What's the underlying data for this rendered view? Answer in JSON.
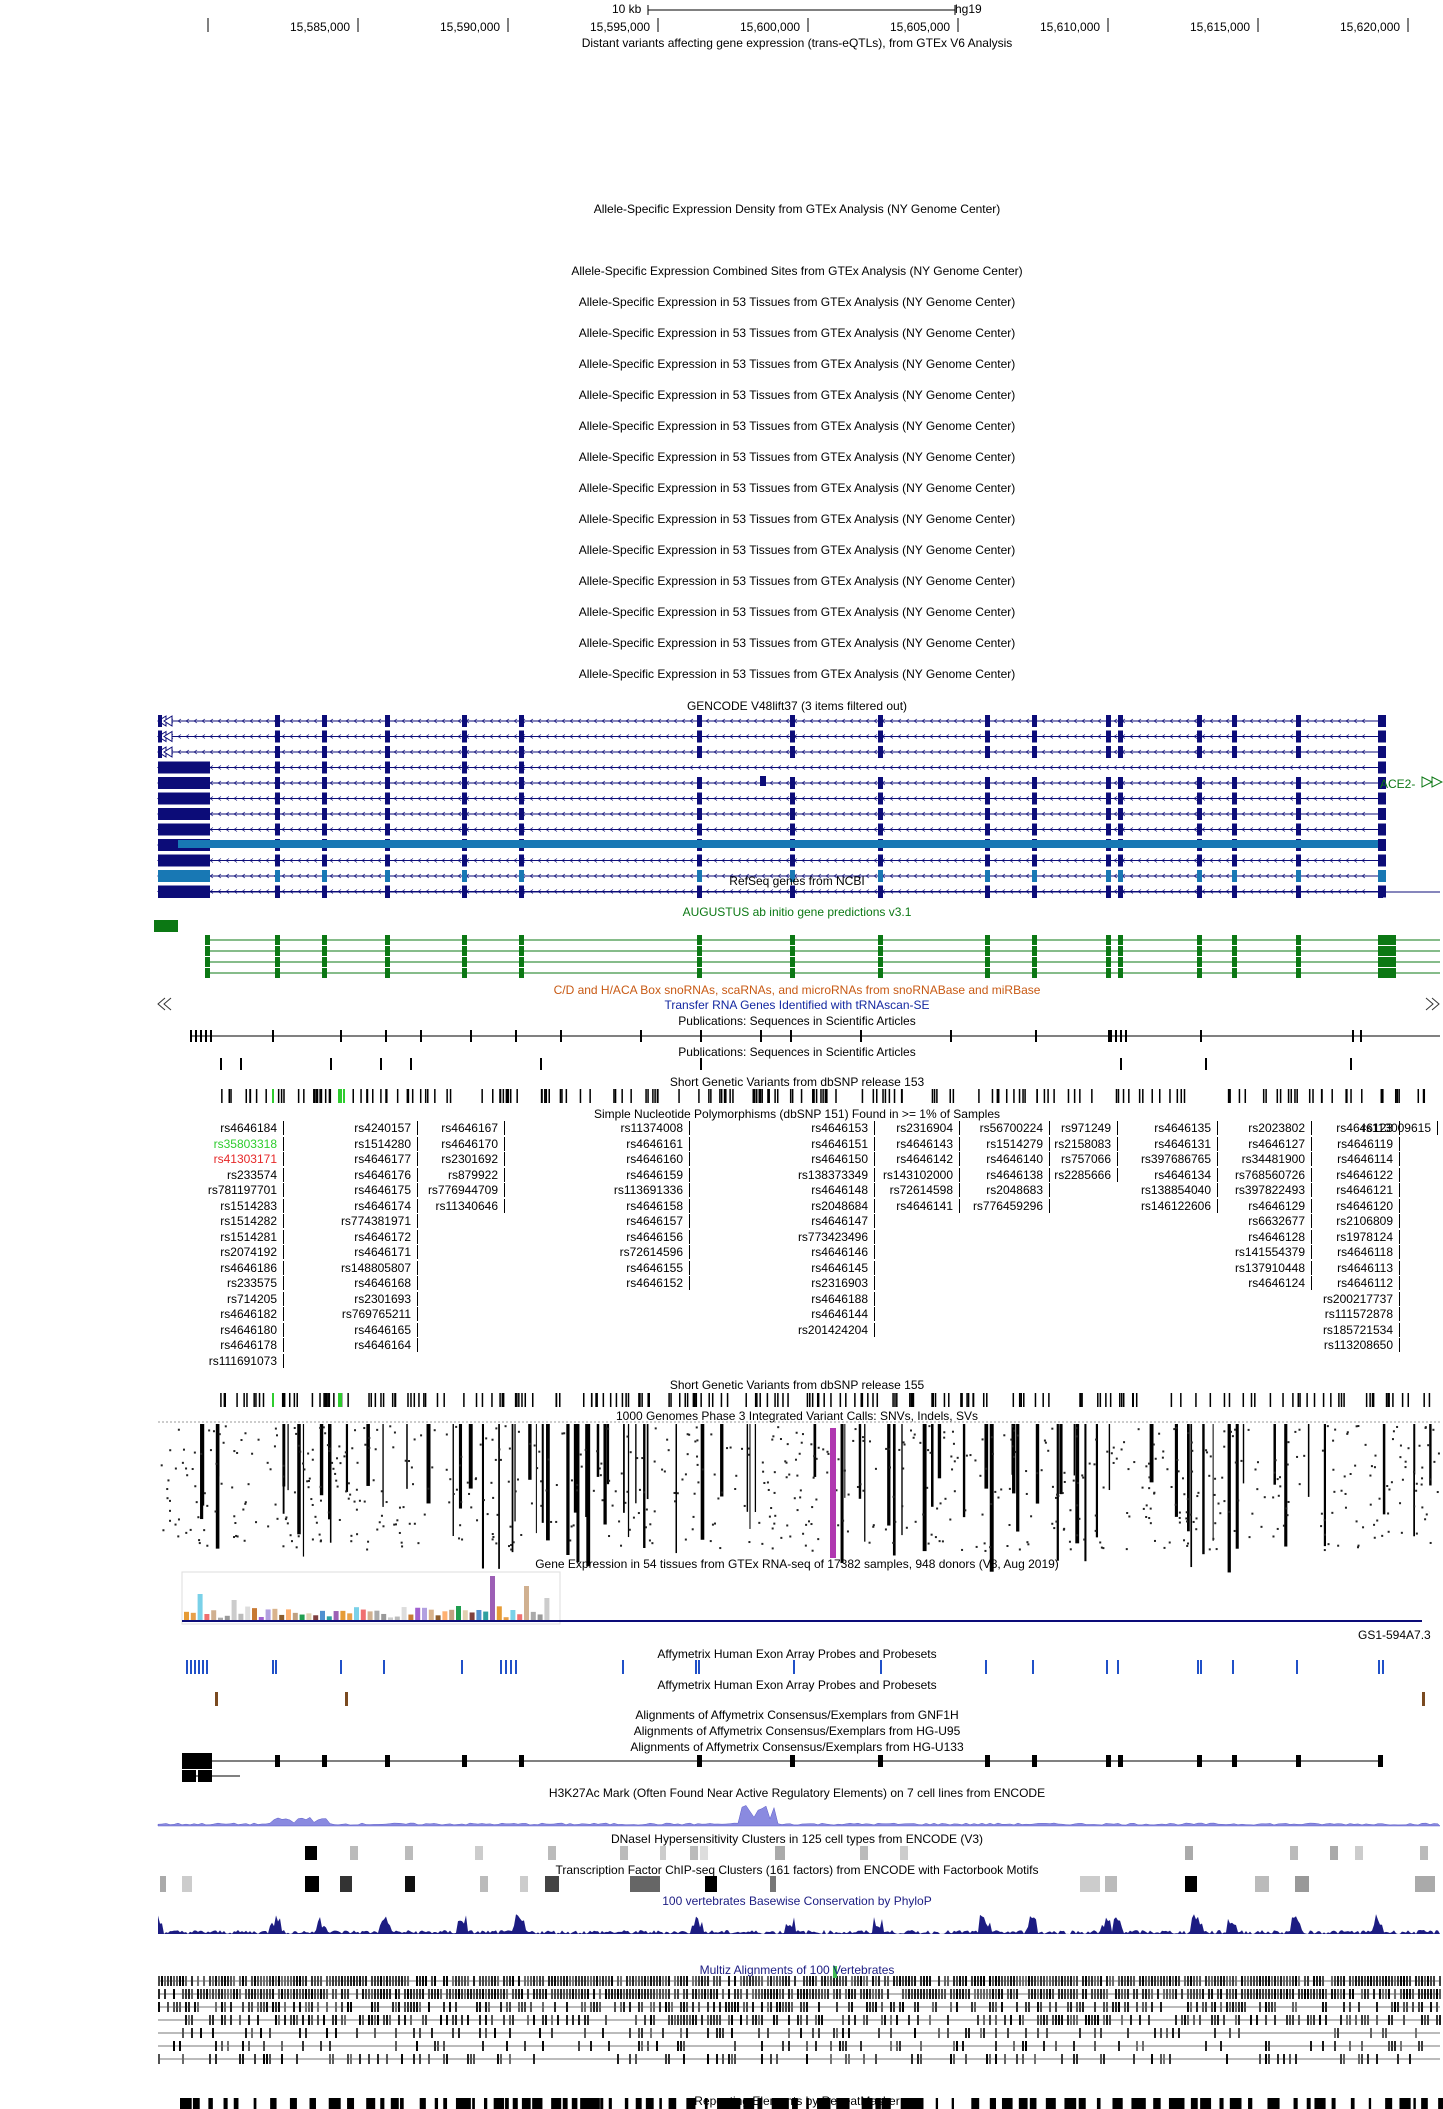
{
  "ruler": {
    "scale_label": "10 kb",
    "assembly": "hg19",
    "coordinates": [
      "15,585,000",
      "15,590,000",
      "15,595,000",
      "15,600,000",
      "15,605,000",
      "15,610,000",
      "15,615,000",
      "15,620,000"
    ]
  },
  "tracks": {
    "trans_eqtl": "Distant variants affecting gene expression (trans-eQTLs), from GTEx V6 Analysis",
    "ase_density": "Allele-Specific Expression Density from GTEx Analysis (NY Genome Center)",
    "ase_combined": "Allele-Specific Expression Combined Sites from GTEx Analysis (NY Genome Center)",
    "ase_tissues": [
      "Allele-Specific Expression in 53 Tissues from GTEx Analysis (NY Genome Center)",
      "Allele-Specific Expression in 53 Tissues from GTEx Analysis (NY Genome Center)",
      "Allele-Specific Expression in 53 Tissues from GTEx Analysis (NY Genome Center)",
      "Allele-Specific Expression in 53 Tissues from GTEx Analysis (NY Genome Center)",
      "Allele-Specific Expression in 53 Tissues from GTEx Analysis (NY Genome Center)",
      "Allele-Specific Expression in 53 Tissues from GTEx Analysis (NY Genome Center)",
      "Allele-Specific Expression in 53 Tissues from GTEx Analysis (NY Genome Center)",
      "Allele-Specific Expression in 53 Tissues from GTEx Analysis (NY Genome Center)",
      "Allele-Specific Expression in 53 Tissues from GTEx Analysis (NY Genome Center)",
      "Allele-Specific Expression in 53 Tissues from GTEx Analysis (NY Genome Center)",
      "Allele-Specific Expression in 53 Tissues from GTEx Analysis (NY Genome Center)",
      "Allele-Specific Expression in 53 Tissues from GTEx Analysis (NY Genome Center)",
      "Allele-Specific Expression in 53 Tissues from GTEx Analysis (NY Genome Center)"
    ],
    "gencode": "GENCODE V48lift37 (3 items filtered out)",
    "gencode_gene": "ACE2-",
    "refseq": "RefSeq genes from NCBI",
    "augustus": "AUGUSTUS ab initio gene predictions v3.1",
    "snorna": "C/D and H/ACA Box snoRNAs, scaRNAs, and microRNAs from snoRNABase and miRBase",
    "trna": "Transfer RNA Genes Identified with tRNAscan-SE",
    "pubs1": "Publications: Sequences in Scientific Articles",
    "pubs2": "Publications: Sequences in Scientific Articles",
    "dbsnp153": "Short Genetic Variants from dbSNP release 153",
    "snp151": "Simple Nucleotide Polymorphisms (dbSNP 151) Found in >= 1% of Samples",
    "dbsnp155": "Short Genetic Variants from dbSNP release 155",
    "kg3": "1000 Genomes Phase 3 Integrated Variant Calls: SNVs, Indels, SVs",
    "gtex": "Gene Expression in 54 tissues from GTEx RNA-seq of 17382 samples, 948 donors (V8, Aug 2019)",
    "gtex_gene": "GS1-594A7.3",
    "affy_exon1": "Affymetrix Human Exon Array Probes and Probesets",
    "affy_exon2": "Affymetrix Human Exon Array Probes and Probesets",
    "affy_gnf1h": "Alignments of Affymetrix Consensus/Exemplars from GNF1H",
    "affy_u95": "Alignments of Affymetrix Consensus/Exemplars from HG-U95",
    "affy_u133": "Alignments of Affymetrix Consensus/Exemplars from HG-U133",
    "h3k27ac": "H3K27Ac Mark (Often Found Near Active Regulatory Elements) on 7 cell lines from ENCODE",
    "dnase": "DNaseI Hypersensitivity Clusters in 125 cell types from ENCODE (V3)",
    "tfbs": "Transcription Factor ChIP-seq Clusters (161 factors) from ENCODE with Factorbook Motifs",
    "phylop": "100 vertebrates Basewise Conservation by PhyloP",
    "multiz": "Multiz Alignments of 100 Vertebrates",
    "rmsk": "Repeating Elements by RepeatMasker"
  },
  "snps": {
    "col1": [
      "rs4646184",
      "rs35803318",
      "rs41303171",
      "rs233574",
      "rs781197701",
      "rs1514283",
      "rs1514282",
      "rs1514281",
      "rs2074192",
      "rs4646186",
      "rs233575",
      "rs714205",
      "rs4646182",
      "rs4646180",
      "rs4646178",
      "rs111691073"
    ],
    "col2": [
      "rs4240157",
      "rs1514280",
      "rs4646177",
      "rs4646176",
      "rs4646175",
      "rs4646174",
      "rs774381971",
      "rs4646172",
      "rs4646171",
      "rs148805807",
      "rs4646168",
      "rs2301693",
      "rs769765211",
      "rs4646165",
      "rs4646164"
    ],
    "col2b": [
      "rs4646167",
      "rs4646170",
      "rs2301692",
      "rs879922",
      "rs776944709",
      "rs11340646"
    ],
    "col3": [
      "rs11374008",
      "rs4646161",
      "rs4646160",
      "rs4646159",
      "rs113691336",
      "rs4646158",
      "rs4646157",
      "rs4646156",
      "rs72614596",
      "rs4646155",
      "rs4646152"
    ],
    "col3b": [
      "rs4646153",
      "rs4646151",
      "rs4646150",
      "rs138373349",
      "rs4646148",
      "rs2048684",
      "rs4646147",
      "rs773423496",
      "rs4646146",
      "rs4646145",
      "rs2316903",
      "rs4646188",
      "rs4646144",
      "rs201424204"
    ],
    "col4": [
      "rs2316904",
      "rs4646143",
      "rs4646142",
      "rs143102000",
      "rs72614598",
      "rs4646141"
    ],
    "col4b": [
      "rs56700224",
      "rs1514279",
      "rs4646140",
      "rs4646138",
      "rs2048683",
      "rs776459296"
    ],
    "col5": [
      "rs971249",
      "rs2158083",
      "rs757066",
      "rs2285666"
    ],
    "col5b": [
      "rs4646135",
      "rs4646131",
      "rs397686765",
      "rs4646134",
      "rs138854040",
      "rs146122606"
    ],
    "col6": [
      "rs2023802",
      "rs4646127",
      "rs34481900",
      "rs768560726",
      "rs397822493",
      "rs4646129",
      "rs6632677",
      "rs4646128",
      "rs141554379",
      "rs137910448",
      "rs4646124"
    ],
    "col6b": [
      "rs4646123",
      "rs4646119",
      "rs4646114",
      "rs4646122",
      "rs4646121",
      "rs4646120",
      "rs2106809",
      "rs1978124",
      "rs4646118",
      "rs4646113",
      "rs4646112",
      "rs200217737",
      "rs111572878",
      "rs185721534",
      "rs113208650"
    ],
    "col7": [
      "rs113009615"
    ]
  },
  "colors": {
    "gencode": "#0c0c78",
    "refseq": "#0c0c78",
    "augustus": "#0c7814",
    "snorna": "#c85a14",
    "trna": "#1428a0",
    "snp_green": "#2ecc2e",
    "snp_red": "#e62828",
    "phylop": "#1c1c82",
    "affy_exon": "#2050c8",
    "gnf": "#000000"
  }
}
